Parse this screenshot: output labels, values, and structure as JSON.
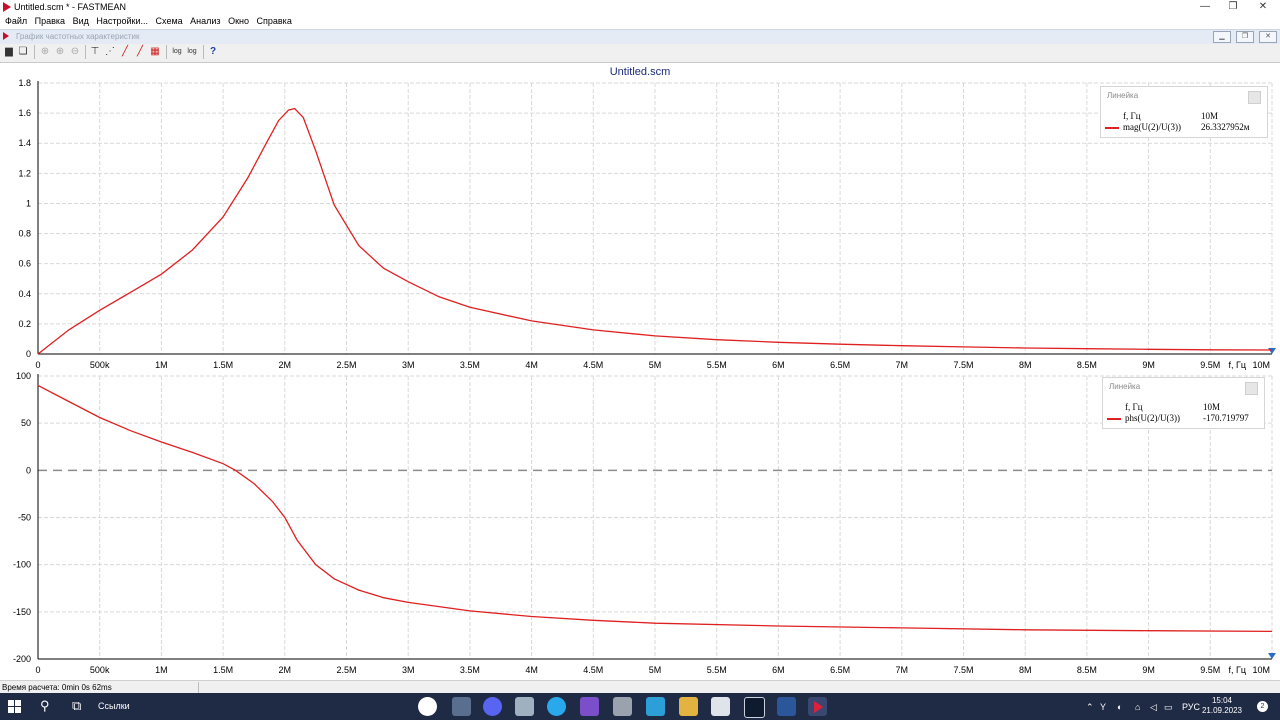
{
  "window": {
    "title": "Untitled.scm * - FASTMEAN",
    "minimize": "—",
    "maximize": "❐",
    "close": "✕"
  },
  "menu": [
    "Файл",
    "Правка",
    "Вид",
    "Настройки...",
    "Схема",
    "Анализ",
    "Окно",
    "Справка"
  ],
  "child_window": {
    "title": "График частотных характеристик"
  },
  "status": {
    "calc_time": "Время расчета: 0min 0s 62ms"
  },
  "taskbar": {
    "links_label": "Ссылки",
    "language": "РУС",
    "time": "15:04",
    "date": "21.09.2023",
    "notifications": "2"
  },
  "legends": [
    {
      "header": "Линейка",
      "x_name": "f, Гц",
      "x_value": "10M",
      "series_name": "mag(U(2)/U(3))",
      "series_value": "26.3327952м",
      "color": "#e02020"
    },
    {
      "header": "Линейка",
      "x_name": "f, Гц",
      "x_value": "10M",
      "series_name": "phs(U(2)/U(3))",
      "series_value": "-170.719797",
      "color": "#e02020"
    }
  ],
  "chart_data": [
    {
      "type": "line",
      "title": "Untitled.scm",
      "xlabel": "f, Гц",
      "ylabel": "",
      "xlim": [
        0,
        10000000
      ],
      "ylim": [
        0,
        1.8
      ],
      "x_ticks": [
        "0",
        "500k",
        "1M",
        "1.5M",
        "2M",
        "2.5M",
        "3M",
        "3.5M",
        "4M",
        "4.5M",
        "5M",
        "5.5M",
        "6M",
        "6.5M",
        "7M",
        "7.5M",
        "8M",
        "8.5M",
        "9M",
        "9.5M",
        "10M"
      ],
      "y_ticks": [
        "0",
        "0.2",
        "0.4",
        "0.6",
        "0.8",
        "1",
        "1.2",
        "1.4",
        "1.6",
        "1.8"
      ],
      "grid": true,
      "legend_position": "top-right",
      "series": [
        {
          "name": "mag(U(2)/U(3))",
          "color": "#e02020",
          "x": [
            0,
            250000,
            500000,
            750000,
            1000000,
            1250000,
            1500000,
            1700000,
            1850000,
            1950000,
            2030000,
            2080000,
            2150000,
            2250000,
            2400000,
            2600000,
            2800000,
            3000000,
            3250000,
            3500000,
            4000000,
            4500000,
            5000000,
            5500000,
            6000000,
            6500000,
            7000000,
            7500000,
            8000000,
            8500000,
            9000000,
            9500000,
            10000000
          ],
          "y": [
            0,
            0.16,
            0.29,
            0.41,
            0.53,
            0.69,
            0.91,
            1.17,
            1.4,
            1.55,
            1.62,
            1.63,
            1.57,
            1.35,
            0.99,
            0.72,
            0.57,
            0.48,
            0.38,
            0.31,
            0.22,
            0.16,
            0.12,
            0.095,
            0.078,
            0.065,
            0.055,
            0.047,
            0.04,
            0.035,
            0.031,
            0.028,
            0.0263
          ]
        }
      ]
    },
    {
      "type": "line",
      "title": "",
      "xlabel": "f, Гц",
      "ylabel": "",
      "xlim": [
        0,
        10000000
      ],
      "ylim": [
        -200,
        100
      ],
      "x_ticks": [
        "0",
        "500k",
        "1M",
        "1.5M",
        "2M",
        "2.5M",
        "3M",
        "3.5M",
        "4M",
        "4.5M",
        "5M",
        "5.5M",
        "6M",
        "6.5M",
        "7M",
        "7.5M",
        "8M",
        "8.5M",
        "9M",
        "9.5M",
        "10M"
      ],
      "y_ticks": [
        "100",
        "50",
        "0",
        "-50",
        "-100",
        "-150",
        "-200"
      ],
      "grid": true,
      "zero_line": "dashed",
      "legend_position": "top-right",
      "series": [
        {
          "name": "phs(U(2)/U(3))",
          "color": "#e02020",
          "x": [
            0,
            250000,
            500000,
            750000,
            1000000,
            1250000,
            1500000,
            1600000,
            1750000,
            1900000,
            2000000,
            2100000,
            2250000,
            2400000,
            2600000,
            2800000,
            3000000,
            3500000,
            4000000,
            4500000,
            5000000,
            6000000,
            7000000,
            8000000,
            9000000,
            10000000
          ],
          "y": [
            90,
            73,
            56,
            42,
            30,
            19,
            7,
            0,
            -14,
            -33,
            -50,
            -74,
            -100,
            -115,
            -127,
            -135,
            -140,
            -149,
            -155,
            -159,
            -162,
            -165,
            -167,
            -169,
            -170,
            -170.72
          ]
        }
      ]
    }
  ]
}
